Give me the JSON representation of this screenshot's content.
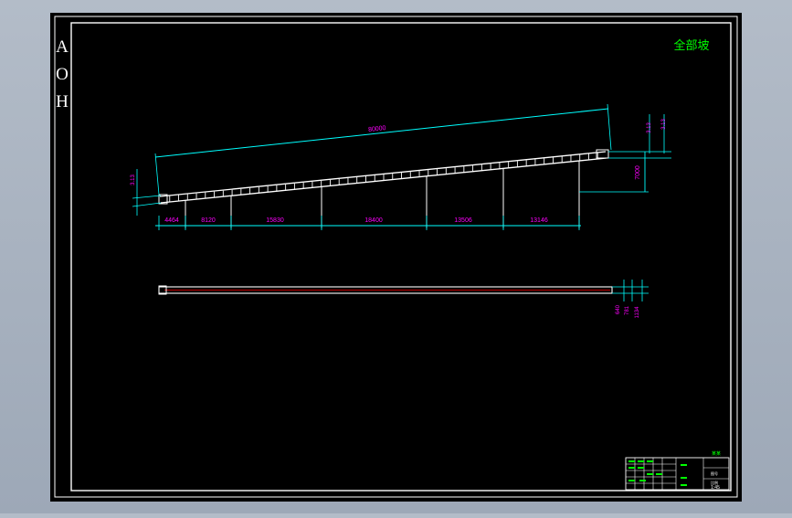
{
  "drawing": {
    "title_label": "全部坡",
    "side_letters": [
      "A",
      "O",
      "H"
    ],
    "colors": {
      "paper": "#000000",
      "frame": "#ffffff",
      "dimension": "#00ffff",
      "dim_text": "#ff00ff",
      "title_text": "#00ff00",
      "outside": "#a7b1bf",
      "red": "#ff0000"
    }
  },
  "elevation": {
    "overall_length": "80000",
    "rise": "7000",
    "top_small_dims": [
      "3.13",
      "3.13"
    ],
    "left_small_dim": "3.13",
    "segments": [
      "4464",
      "8120",
      "15830",
      "18400",
      "13506",
      "13146"
    ]
  },
  "plan": {
    "dims": [
      "640",
      "781",
      "1134"
    ]
  },
  "title_block": {
    "labels": [
      "某某",
      "图号",
      "比例",
      "1:45"
    ]
  }
}
